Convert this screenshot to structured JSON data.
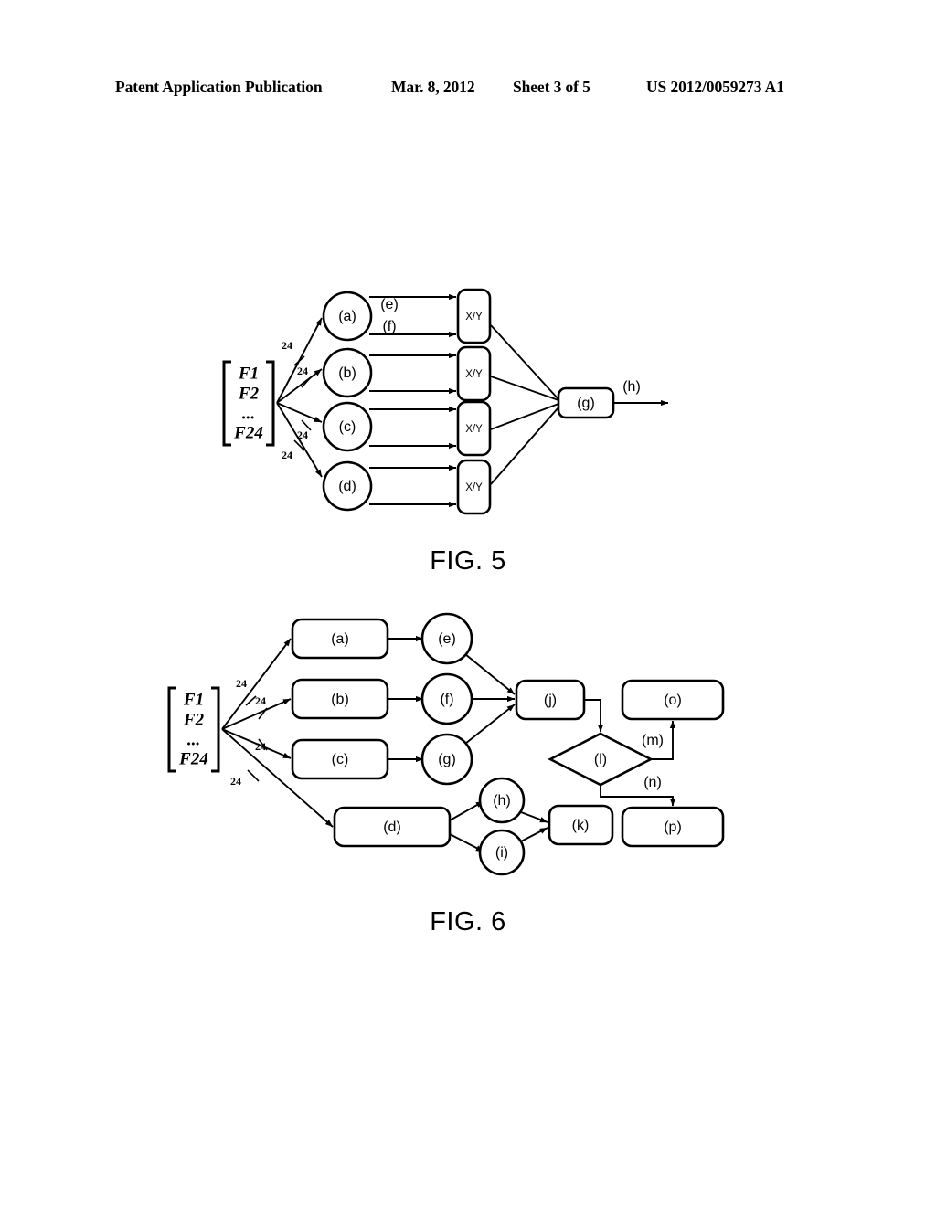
{
  "header": {
    "publication": "Patent Application Publication",
    "date": "Mar. 8, 2012",
    "sheet": "Sheet 3 of 5",
    "document_number": "US 2012/0059273 A1"
  },
  "figures": [
    {
      "caption": "FIG. 5",
      "input_matrix": {
        "rows": [
          "F1",
          "F2",
          "...",
          "F24"
        ]
      },
      "bus_labels": [
        "24",
        "24",
        "24",
        "24"
      ],
      "nodes": [
        {
          "id": "a",
          "label": "(a)",
          "shape": "circle"
        },
        {
          "id": "b",
          "label": "(b)",
          "shape": "circle"
        },
        {
          "id": "c",
          "label": "(c)",
          "shape": "circle"
        },
        {
          "id": "d",
          "label": "(d)",
          "shape": "circle"
        },
        {
          "id": "xy1",
          "label": "X/Y",
          "shape": "rounded-rect"
        },
        {
          "id": "xy2",
          "label": "X/Y",
          "shape": "rounded-rect"
        },
        {
          "id": "xy3",
          "label": "X/Y",
          "shape": "rounded-rect"
        },
        {
          "id": "xy4",
          "label": "X/Y",
          "shape": "rounded-rect"
        },
        {
          "id": "g",
          "label": "(g)",
          "shape": "rounded-rect"
        }
      ],
      "edge_labels": [
        {
          "id": "e",
          "label": "(e)"
        },
        {
          "id": "f",
          "label": "(f)"
        },
        {
          "id": "h",
          "label": "(h)"
        }
      ]
    },
    {
      "caption": "FIG. 6",
      "input_matrix": {
        "rows": [
          "F1",
          "F2",
          "...",
          "F24"
        ]
      },
      "bus_labels": [
        "24",
        "24",
        "24",
        "24"
      ],
      "nodes": [
        {
          "id": "a",
          "label": "(a)",
          "shape": "rounded-rect"
        },
        {
          "id": "b",
          "label": "(b)",
          "shape": "rounded-rect"
        },
        {
          "id": "c",
          "label": "(c)",
          "shape": "rounded-rect"
        },
        {
          "id": "d",
          "label": "(d)",
          "shape": "rounded-rect"
        },
        {
          "id": "e",
          "label": "(e)",
          "shape": "circle"
        },
        {
          "id": "f",
          "label": "(f)",
          "shape": "circle"
        },
        {
          "id": "g",
          "label": "(g)",
          "shape": "circle"
        },
        {
          "id": "h",
          "label": "(h)",
          "shape": "circle"
        },
        {
          "id": "i",
          "label": "(i)",
          "shape": "circle"
        },
        {
          "id": "j",
          "label": "(j)",
          "shape": "rounded-rect"
        },
        {
          "id": "k",
          "label": "(k)",
          "shape": "rounded-rect"
        },
        {
          "id": "l",
          "label": "(l)",
          "shape": "diamond"
        },
        {
          "id": "o",
          "label": "(o)",
          "shape": "rounded-rect"
        },
        {
          "id": "p",
          "label": "(p)",
          "shape": "rounded-rect"
        }
      ],
      "edge_labels": [
        {
          "id": "m",
          "label": "(m)"
        },
        {
          "id": "n",
          "label": "(n)"
        }
      ]
    }
  ]
}
